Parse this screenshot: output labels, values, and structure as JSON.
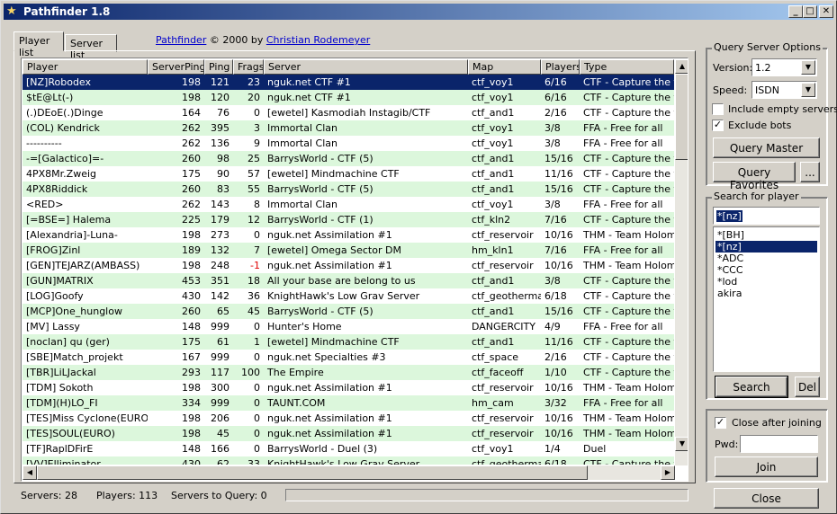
{
  "window": {
    "title": "Pathfinder 1.8",
    "minimize": "_",
    "maximize": "□",
    "close": "✕"
  },
  "tabs": [
    {
      "label": "Player list"
    },
    {
      "label": "Server list"
    }
  ],
  "credits": {
    "app_link": "Pathfinder",
    "text": "© 2000 by",
    "author_link": "Christian Rodemeyer"
  },
  "columns": [
    "Player",
    "ServerPing",
    "Ping",
    "Frags",
    "Server",
    "Map",
    "Players",
    "Type"
  ],
  "rows": [
    [
      "[NZ]Robodex",
      "198",
      "121",
      "23",
      "nguk.net CTF #1",
      "ctf_voy1",
      "6/16",
      "CTF - Capture the flag"
    ],
    [
      "$tE@Lt(-)",
      "198",
      "120",
      "20",
      "nguk.net CTF #1",
      "ctf_voy1",
      "6/16",
      "CTF - Capture the flag"
    ],
    [
      "(.)DEoE(.)Dinge",
      "164",
      "76",
      "0",
      "[ewetel] Kasmodiah Instagib/CTF",
      "ctf_and1",
      "2/16",
      "CTF - Capture the flag"
    ],
    [
      "(COL) Kendrick",
      "262",
      "395",
      "3",
      "Immortal Clan",
      "ctf_voy1",
      "3/8",
      "FFA - Free for all"
    ],
    [
      "----------",
      "262",
      "136",
      "9",
      "Immortal Clan",
      "ctf_voy1",
      "3/8",
      "FFA - Free for all"
    ],
    [
      "-=[Galactico]=-",
      "260",
      "98",
      "25",
      "BarrysWorld - CTF (5)",
      "ctf_and1",
      "15/16",
      "CTF - Capture the flag"
    ],
    [
      "4PX8Mr.Zweig",
      "175",
      "90",
      "57",
      "[ewetel] Mindmachine CTF",
      "ctf_and1",
      "11/16",
      "CTF - Capture the flag"
    ],
    [
      "4PX8Riddick",
      "260",
      "83",
      "55",
      "BarrysWorld - CTF (5)",
      "ctf_and1",
      "15/16",
      "CTF - Capture the flag"
    ],
    [
      "<RED>",
      "262",
      "143",
      "8",
      "Immortal Clan",
      "ctf_voy1",
      "3/8",
      "FFA - Free for all"
    ],
    [
      "[=BSE=] Halema",
      "225",
      "179",
      "12",
      "BarrysWorld - CTF (1)",
      "ctf_kln2",
      "7/16",
      "CTF - Capture the flag"
    ],
    [
      "[Alexandria]-Luna-",
      "198",
      "273",
      "0",
      "nguk.net Assimilation #1",
      "ctf_reservoir",
      "10/16",
      "THM - Team Holomatch"
    ],
    [
      "[FROG]Zinl",
      "189",
      "132",
      "7",
      "[ewetel] Omega Sector DM",
      "hm_kln1",
      "7/16",
      "FFA - Free for all"
    ],
    [
      "[GEN]TEJARZ(AMBASS)",
      "198",
      "248",
      "-1",
      "nguk.net Assimilation #1",
      "ctf_reservoir",
      "10/16",
      "THM - Team Holomatch"
    ],
    [
      "[GUN]MATRIX",
      "453",
      "351",
      "18",
      "All your base are belong to us",
      "ctf_and1",
      "3/8",
      "CTF - Capture the flag"
    ],
    [
      "[LOG]Goofy",
      "430",
      "142",
      "36",
      "KnightHawk's Low Grav Server",
      "ctf_geothermal",
      "6/18",
      "CTF - Capture the flag"
    ],
    [
      "[MCP]One_hunglow",
      "260",
      "65",
      "45",
      "BarrysWorld - CTF (5)",
      "ctf_and1",
      "15/16",
      "CTF - Capture the flag"
    ],
    [
      "[MV] Lassy",
      "148",
      "999",
      "0",
      "Hunter's Home",
      "DANGERCITY",
      "4/9",
      "FFA - Free for all"
    ],
    [
      "[noclan] qu (ger)",
      "175",
      "61",
      "1",
      "[ewetel] Mindmachine CTF",
      "ctf_and1",
      "11/16",
      "CTF - Capture the flag"
    ],
    [
      "[SBE]Match_projekt",
      "167",
      "999",
      "0",
      "nguk.net Specialties #3",
      "ctf_space",
      "2/16",
      "CTF - Capture the flag"
    ],
    [
      "[TBR]LiLJackal",
      "293",
      "117",
      "100",
      "The Empire",
      "ctf_faceoff",
      "1/10",
      "CTF - Capture the flag"
    ],
    [
      "[TDM] Sokoth",
      "198",
      "300",
      "0",
      "nguk.net Assimilation #1",
      "ctf_reservoir",
      "10/16",
      "THM - Team Holomatch"
    ],
    [
      "[TDM](H)LO_FI",
      "334",
      "999",
      "0",
      "TAUNT.COM",
      "hm_cam",
      "3/32",
      "FFA - Free for all"
    ],
    [
      "[TES]Miss Cyclone(EURO)",
      "198",
      "206",
      "0",
      "nguk.net Assimilation #1",
      "ctf_reservoir",
      "10/16",
      "THM - Team Holomatch"
    ],
    [
      "[TES]SOUL(EURO)",
      "198",
      "45",
      "0",
      "nguk.net Assimilation #1",
      "ctf_reservoir",
      "10/16",
      "THM - Team Holomatch"
    ],
    [
      "[TF]RaplDFirE",
      "148",
      "166",
      "0",
      "BarrysWorld - Duel (3)",
      "ctf_voy1",
      "1/4",
      "Duel"
    ],
    [
      "[VV]Elliminator",
      "430",
      "62",
      "33",
      "KnightHawk's Low Grav Server",
      "ctf_geothermal",
      "6/18",
      "CTF - Capture the flag"
    ]
  ],
  "scrollbar": {
    "up": "▲",
    "down": "▼",
    "left": "◀",
    "right": "▶"
  },
  "status": {
    "servers": "Servers: 28",
    "players": "Players: 113",
    "to_query": "Servers to Query: 0"
  },
  "query": {
    "group_title": "Query Server Options",
    "version_label": "Version:",
    "version_value": "1.2",
    "speed_label": "Speed:",
    "speed_value": "ISDN",
    "include_empty_label": "Include empty servers",
    "include_empty_checked": false,
    "exclude_bots_label": "Exclude bots",
    "exclude_bots_checked": true,
    "query_master": "Query Master",
    "query_favorites": "Query Favorites",
    "more": "..."
  },
  "search": {
    "group_title": "Search for player",
    "input_value": "*[nz]",
    "items": [
      "*[BH]",
      "*[nz]",
      "*ADC",
      "*CCC",
      "*lod",
      "akira"
    ],
    "selected_index": 1,
    "search_button": "Search",
    "del_button": "Del"
  },
  "join": {
    "close_after_label": "Close after joining",
    "close_after_checked": true,
    "pwd_label": "Pwd:",
    "join_button": "Join"
  },
  "close_button": "Close",
  "colors": {
    "selected": "#0a246a",
    "even_row": "#dcf7dc",
    "negative": "#e00000",
    "link": "#0000cc"
  }
}
